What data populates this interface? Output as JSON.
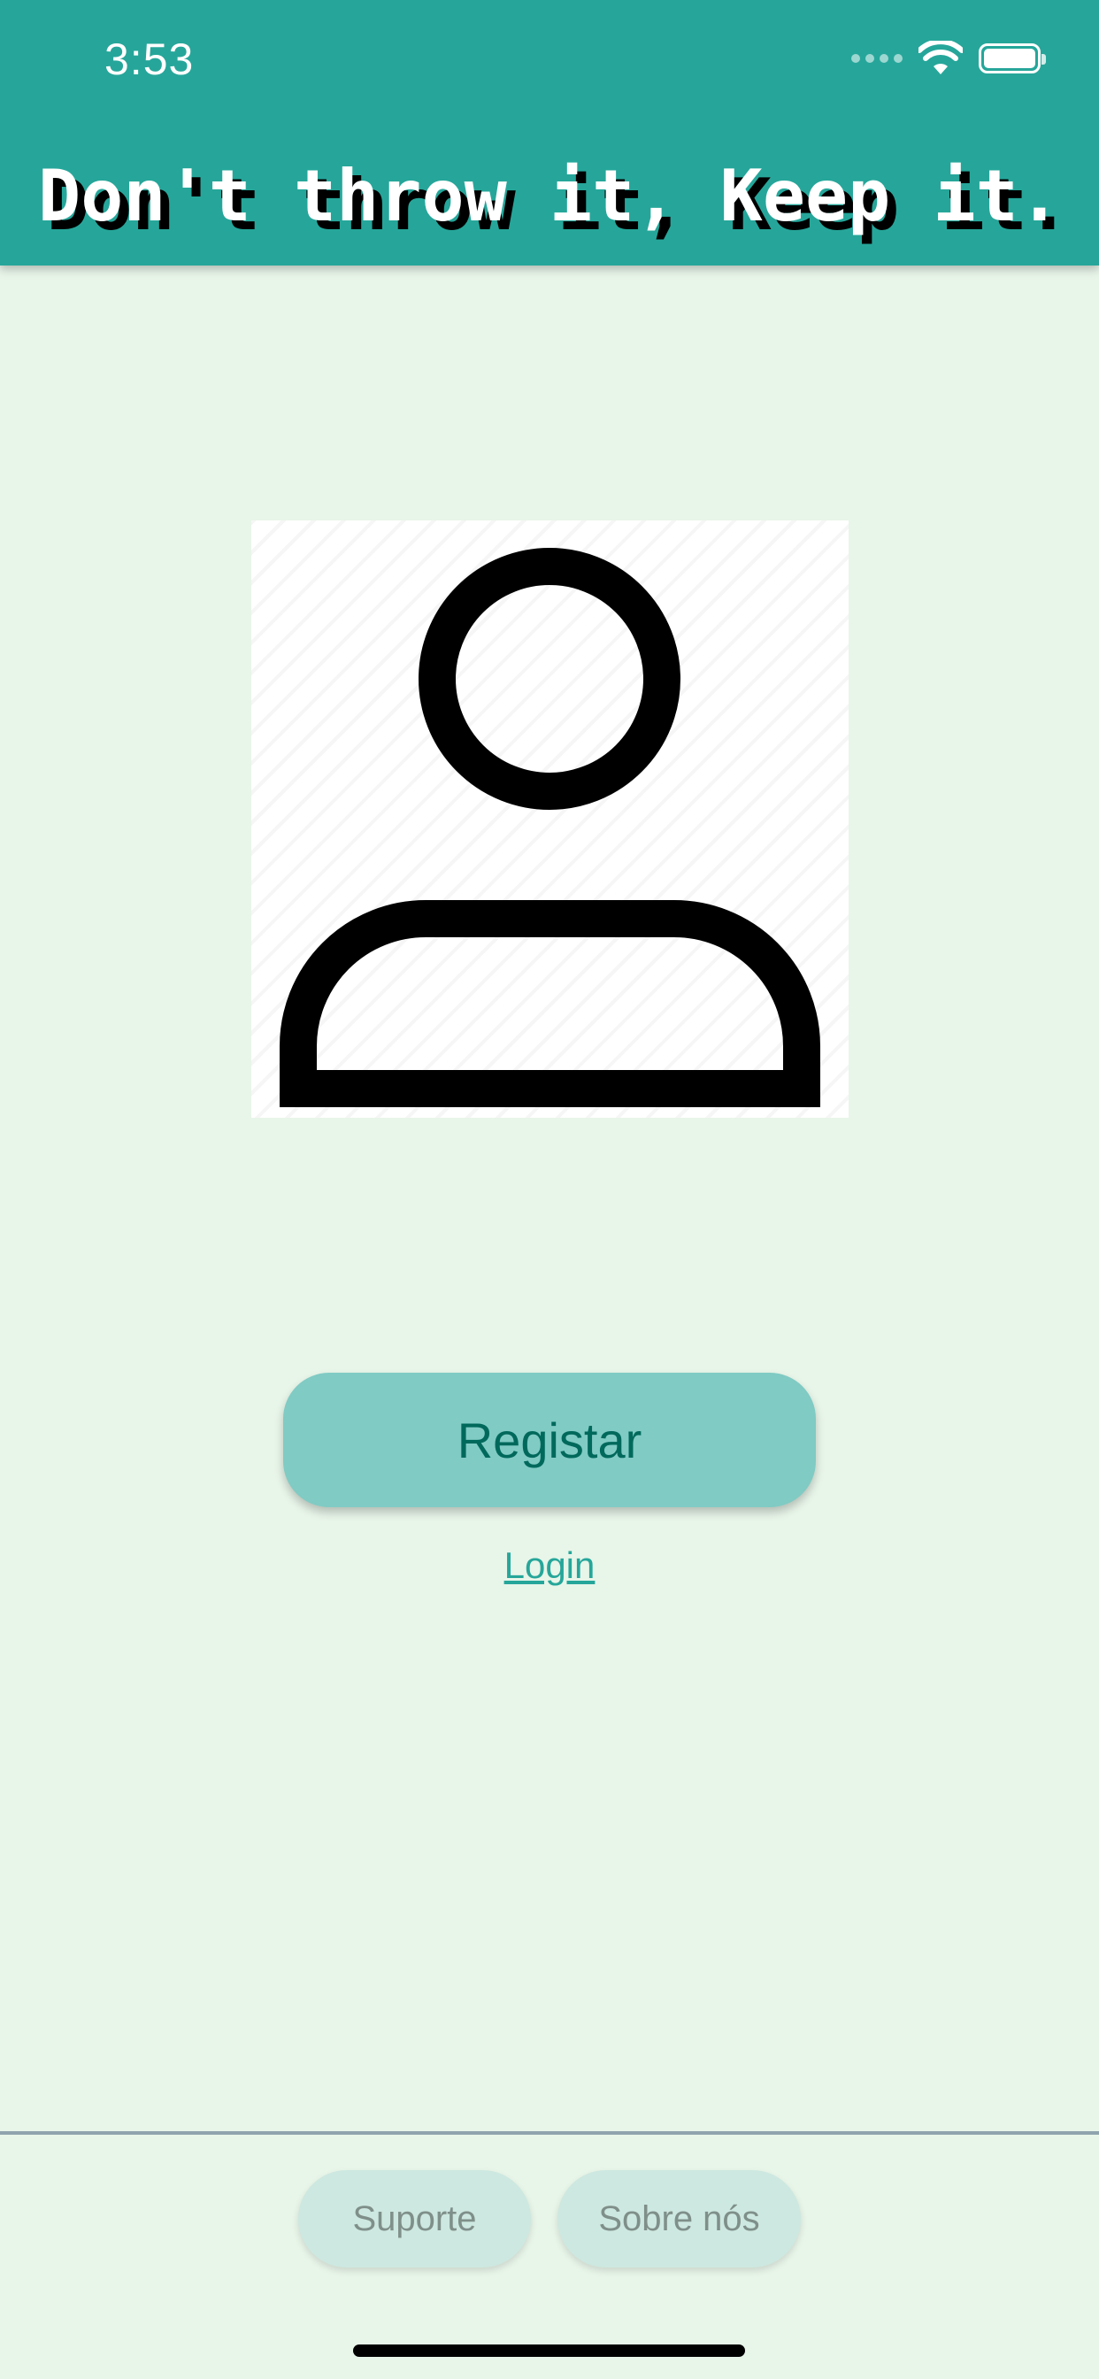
{
  "status_bar": {
    "time": "3:53",
    "icons": [
      "cellular-signal-icon",
      "wifi-icon",
      "battery-icon"
    ]
  },
  "header": {
    "title": "Don't throw it, Keep it.",
    "background_color": "#26a69a"
  },
  "avatar": {
    "icon": "user-avatar-icon"
  },
  "actions": {
    "register_label": "Registar",
    "login_label": "Login"
  },
  "footer": {
    "support_label": "Suporte",
    "about_label": "Sobre nós"
  },
  "colors": {
    "page_background": "#e8f5e9",
    "button_background": "#80cbc4",
    "button_text": "#00695c",
    "link": "#26a69a"
  }
}
